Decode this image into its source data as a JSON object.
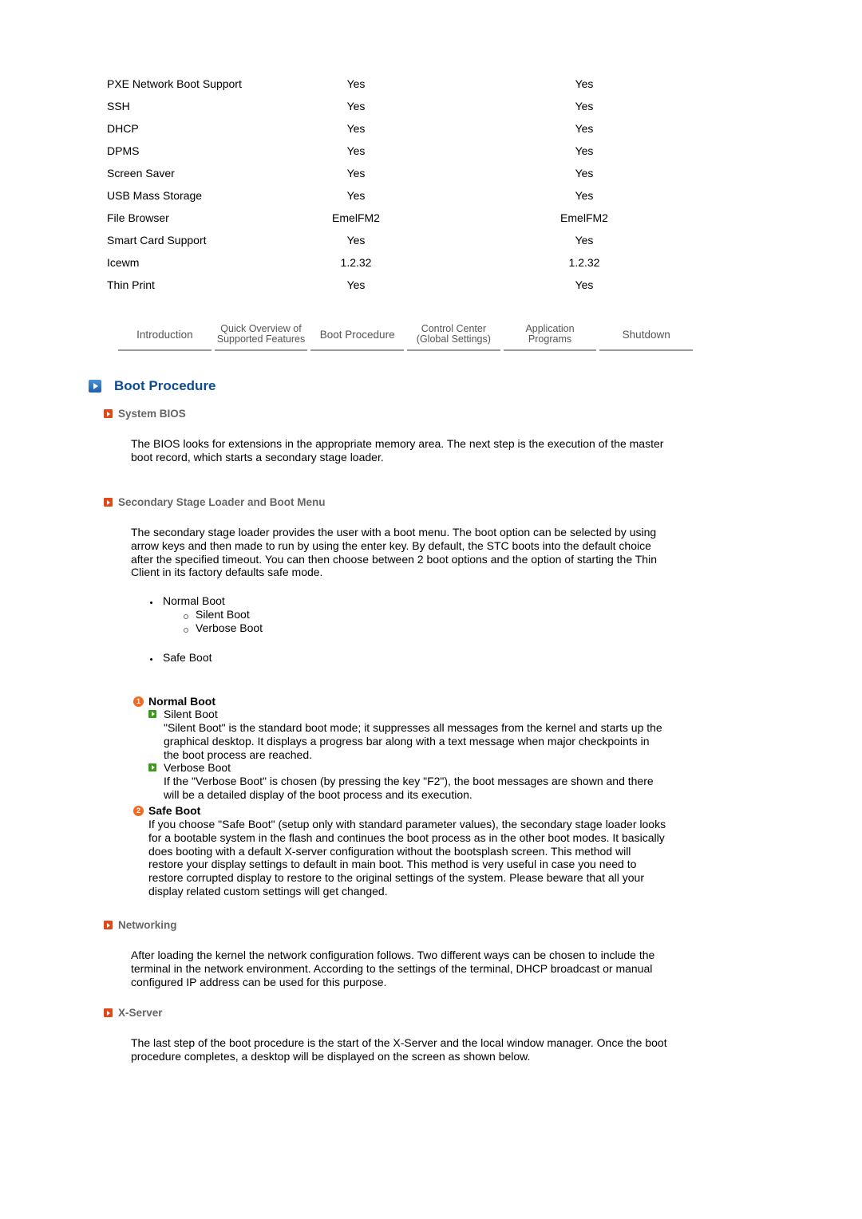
{
  "features_table": {
    "rows": [
      [
        "PXE Network Boot Support",
        "Yes",
        "Yes"
      ],
      [
        "SSH",
        "Yes",
        "Yes"
      ],
      [
        "DHCP",
        "Yes",
        "Yes"
      ],
      [
        "DPMS",
        "Yes",
        "Yes"
      ],
      [
        "Screen Saver",
        "Yes",
        "Yes"
      ],
      [
        "USB Mass Storage",
        "Yes",
        "Yes"
      ],
      [
        "File Browser",
        "EmelFM2",
        "EmelFM2"
      ],
      [
        "Smart Card Support",
        "Yes",
        "Yes"
      ],
      [
        "Icewm",
        "1.2.32",
        "1.2.32"
      ],
      [
        "Thin Print",
        "Yes",
        "Yes"
      ]
    ]
  },
  "nav": {
    "tabs": [
      {
        "line1": "Introduction",
        "line2": ""
      },
      {
        "line1": "Quick Overview of",
        "line2": "Supported Features"
      },
      {
        "line1": "Boot Procedure",
        "line2": ""
      },
      {
        "line1": "Control Center",
        "line2": "(Global Settings)"
      },
      {
        "line1": "Application",
        "line2": "Programs"
      },
      {
        "line1": "Shutdown",
        "line2": ""
      }
    ]
  },
  "section": {
    "title": "Boot Procedure",
    "system_bios": {
      "heading": "System BIOS",
      "text": "The BIOS looks for extensions in the appropriate memory area. The next step is the execution of the master boot record, which starts a secondary stage loader."
    },
    "loader": {
      "heading": "Secondary Stage Loader and Boot Menu",
      "text": "The secondary stage loader provides the user with a boot menu. The boot option can be selected by using arrow keys and then made to run by using the enter key. By default, the STC boots into the default choice after the specified timeout. You can then choose between 2 boot options and the option of starting the Thin Client in its factory defaults safe mode.",
      "list": {
        "normal": "Normal Boot",
        "silent": "Silent Boot",
        "verbose": "Verbose Boot",
        "safe": "Safe Boot"
      }
    },
    "normal_boot": {
      "number": "1",
      "heading": "Normal Boot",
      "silent_label": "Silent Boot",
      "silent_text": "\"Silent Boot\" is the standard boot mode; it suppresses all messages from the kernel and starts up the graphical desktop. It displays a progress bar along with a text message when major checkpoints in the boot process are reached.",
      "verbose_label": "Verbose Boot",
      "verbose_text": "If the \"Verbose Boot\" is chosen (by pressing the key \"F2\"), the boot messages are shown and there will be a detailed display of the boot process and its execution."
    },
    "safe_boot": {
      "number": "2",
      "heading": "Safe Boot",
      "text": "If you choose \"Safe Boot\" (setup only with standard parameter values), the secondary stage loader looks for a bootable system in the flash and continues the boot process as in the other boot modes. It basically does booting with a default X-server configuration without the bootsplash screen. This method will restore your display settings to default in main boot. This method is very useful in case you need to restore corrupted display to restore to the original settings of the system. Please beware that all your display related custom settings will get changed."
    },
    "networking": {
      "heading": "Networking",
      "text": "After loading the kernel the network configuration follows. Two different ways can be chosen to include the terminal in the network environment. According to the settings of the terminal, DHCP broadcast or manual configured IP address can be used for this purpose."
    },
    "xserver": {
      "heading": "X-Server",
      "text": "The last step of the boot procedure is the start of the X-Server and the local window manager. Once the boot procedure completes, a desktop will be displayed on the screen as shown below."
    }
  },
  "colors": {
    "title_blue": "#0f4c8f",
    "heading_gray": "#666666",
    "bullet_orange": "#e04a1a",
    "sub_green": "#3a9a1a"
  }
}
